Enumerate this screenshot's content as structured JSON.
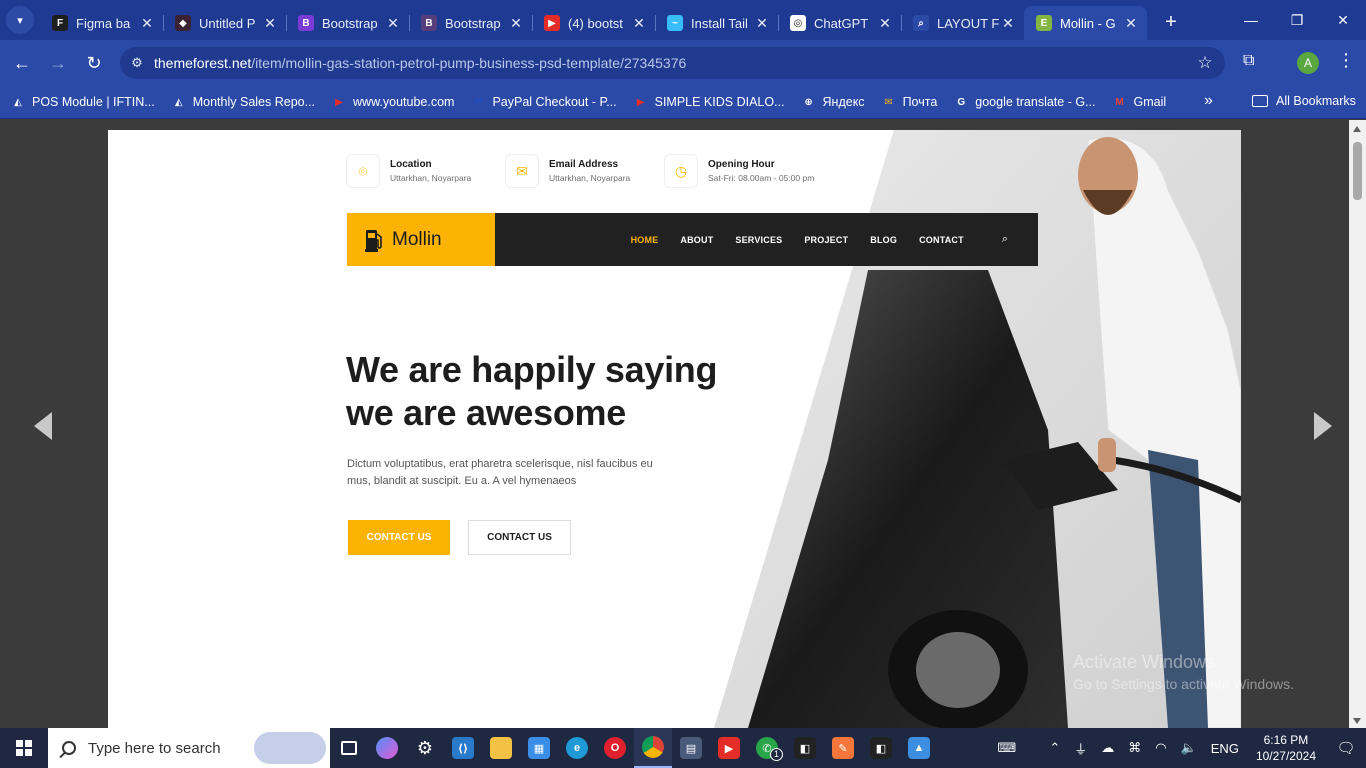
{
  "browser": {
    "tabs": [
      {
        "title": "Figma ba",
        "color": "#1e1e1e",
        "glyph": "F",
        "active": false
      },
      {
        "title": "Untitled P",
        "color": "#3a2233",
        "glyph": "◆",
        "active": false
      },
      {
        "title": "Bootstrap",
        "color": "#7b3bd6",
        "glyph": "B",
        "active": false
      },
      {
        "title": "Bootstrap",
        "color": "#563d7c",
        "glyph": "B",
        "active": false
      },
      {
        "title": "(4) bootst",
        "color": "#e52d27",
        "glyph": "▶",
        "active": false
      },
      {
        "title": "Install Tail",
        "color": "#38bdf8",
        "glyph": "~",
        "active": false
      },
      {
        "title": "ChatGPT",
        "color": "#ffffff",
        "glyph": "◎",
        "active": false
      },
      {
        "title": "LAYOUT F",
        "color": "#2b4aa8",
        "glyph": "⌕",
        "active": false
      },
      {
        "title": "Mollin - G",
        "color": "#82b541",
        "glyph": "E",
        "active": true
      }
    ],
    "url_domain": "themeforest.net",
    "url_path": "/item/mollin-gas-station-petrol-pump-business-psd-template/27345376",
    "profile_initial": "A",
    "bookmarks": [
      {
        "label": "POS Module | IFTIN...",
        "color": "#ffffff",
        "glyph": "◭"
      },
      {
        "label": "Monthly Sales Repo...",
        "color": "#ffffff",
        "glyph": "◭"
      },
      {
        "label": "www.youtube.com",
        "color": "#e52d27",
        "glyph": "▶"
      },
      {
        "label": "PayPal Checkout - P...",
        "color": "#1f4fbf",
        "glyph": "P"
      },
      {
        "label": "SIMPLE KIDS DIALO...",
        "color": "#e52d27",
        "glyph": "▶"
      },
      {
        "label": "Яндекс",
        "color": "#ffffff",
        "glyph": "⊕"
      },
      {
        "label": "Почта",
        "color": "#f5b400",
        "glyph": "✉"
      },
      {
        "label": "google translate - G...",
        "color": "#ffffff",
        "glyph": "G"
      },
      {
        "label": "Gmail",
        "color": "#ea4335",
        "glyph": "M"
      }
    ],
    "all_bookmarks_label": "All Bookmarks"
  },
  "site": {
    "info": [
      {
        "title": "Location",
        "sub": "Uttarkhan, Noyarpara",
        "icon": "location-pin-icon",
        "glyph": "⌾"
      },
      {
        "title": "Email Address",
        "sub": "Uttarkhan, Noyarpara",
        "icon": "envelope-icon",
        "glyph": "✉"
      },
      {
        "title": "Opening Hour",
        "sub": "Sat-Fri: 08.00am - 05:00 pm",
        "icon": "clock-icon",
        "glyph": "◷"
      }
    ],
    "logo_text": "Mollin",
    "menu": [
      "HOME",
      "ABOUT",
      "SERVICES",
      "PROJECT",
      "BLOG",
      "CONTACT"
    ],
    "active_menu": "HOME",
    "hero_title_line1": "We are happily saying",
    "hero_title_line2": "we are awesome",
    "hero_text": "Dictum voluptatibus, erat pharetra scelerisque, nisl faucibus eu mus, blandit at suscipit. Eu a. A vel hymenaeos",
    "button_primary": "CONTACT US",
    "button_secondary": "CONTACT US",
    "accent_color": "#fdb304"
  },
  "watermark": {
    "line1": "Activate Windows",
    "line2": "Go to Settings to activate Windows."
  },
  "taskbar": {
    "search_placeholder": "Type here to search",
    "language": "ENG",
    "time": "6:16 PM",
    "date": "10/27/2024",
    "whatsapp_badge": "1"
  }
}
